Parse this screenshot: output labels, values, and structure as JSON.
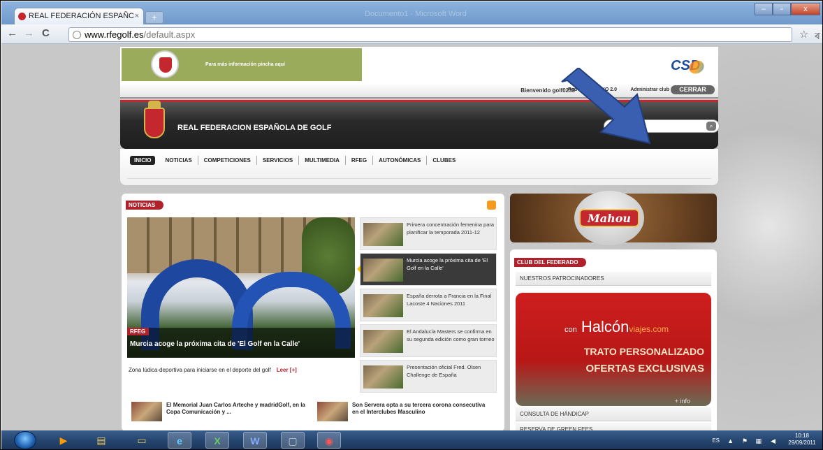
{
  "browser": {
    "tab_title": "REAL FEDERACIÓN ESPAÑC",
    "tab_close": "×",
    "new_tab": "+",
    "url_domain": "www.rfegolf.es",
    "url_path": "/default.aspx",
    "back": "←",
    "forward": "→",
    "reload": "C",
    "star": "☆",
    "wrench": "ৰ",
    "ghost_title": "Documento1 - Microsoft Word",
    "minimize": "–",
    "maximize": "▫",
    "close": "x"
  },
  "site": {
    "promo_text": "Para más información pincha aquí",
    "csd_logo": "CSD",
    "welcome": "Bienvenido golf0233",
    "red_social": "Red Social HOYO 2.0",
    "admin": "Administrar club",
    "cerrar": "CERRAR",
    "header_title": "REAL FEDERACION ESPAÑOLA DE GOLF",
    "search_icon": "search-icon",
    "menu": [
      "INICIO",
      "NOTICIAS",
      "COMPETICIONES",
      "SERVICIOS",
      "MULTIMEDIA",
      "RFEG",
      "AUTONÓMICAS",
      "CLUBES"
    ],
    "noticias_badge": "NOTICIAS",
    "feature": {
      "tag": "RFEG",
      "title": "Murcia acoge la próxima cita de 'El Golf en la Calle'",
      "summary": "Zona lúdica-deportiva para iniciarse en el deporte del golf",
      "leer": "Leer [+]"
    },
    "news": [
      {
        "text": "Primera concentración femenina para planificar la temporada 2011-12"
      },
      {
        "text": "Murcia acoge la próxima cita de 'El Golf en la Calle'"
      },
      {
        "text": "España derrota a Francia en la Final Lacoste 4 Naciones 2011"
      },
      {
        "text": "El Andalucía Masters se confirma en su segunda edición como gran torneo"
      },
      {
        "text": "Presentación oficial Fred. Olsen Challenge de España"
      }
    ],
    "bottom_news": [
      {
        "text": "El Memorial Juan Carlos Arteche y madridGolf, en la Copa Comunicación y ..."
      },
      {
        "text": "Son Servera opta a su tercera corona consecutiva en el Interclubes Masculino"
      }
    ],
    "mahou": "Mahou",
    "club_badge": "CLUB DEL FEDERADO",
    "patrocinadores": "NUESTROS PATROCINADORES",
    "halcon_pre": "con",
    "halcon_brand": "Halcón",
    "halcon_suffix": "viajes.com",
    "trato": "TRATO PERSONALIZADO",
    "ofertas": "OFERTAS EXCLUSIVAS",
    "info": "+ info",
    "handicap": "CONSULTA DE HÁNDICAP",
    "reserva": "RESERVA DE GREEN FEES"
  },
  "taskbar": {
    "apps": [
      "media-player-icon",
      "file-explorer-icon",
      "folder-icon",
      "internet-explorer-icon",
      "excel-icon",
      "word-icon",
      "window-icon",
      "chrome-icon"
    ],
    "lang": "ES",
    "time": "10:18",
    "date": "29/09/2011"
  },
  "colors": {
    "accent": "#b0222b",
    "arrow": "#3a5fb0"
  }
}
